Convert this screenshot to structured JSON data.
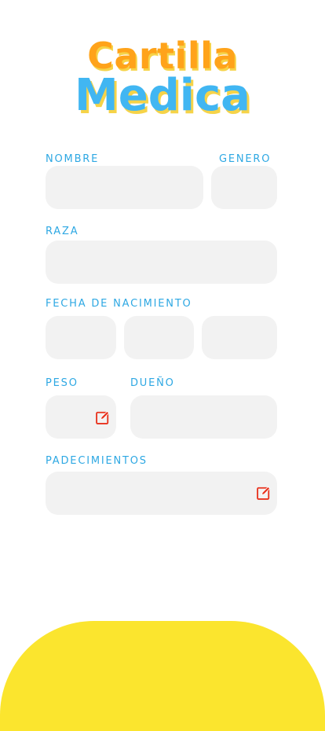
{
  "title": {
    "line1": "Cartilla",
    "line2": "Medica"
  },
  "form": {
    "nombre": {
      "label": "NOMBRE",
      "value": ""
    },
    "genero": {
      "label": "GENERO",
      "value": ""
    },
    "raza": {
      "label": "RAZA",
      "value": ""
    },
    "fecha": {
      "label": "FECHA DE NACIMIENTO",
      "day": "",
      "month": "",
      "year": ""
    },
    "peso": {
      "label": "PESO",
      "value": "",
      "icon": "edit-icon"
    },
    "dueno": {
      "label": "DUEÑO",
      "value": ""
    },
    "padecimientos": {
      "label": "PADECIMIENTOS",
      "value": "",
      "icon": "edit-icon"
    }
  },
  "colors": {
    "accent_blue": "#41B6F2",
    "accent_orange": "#FFA31A",
    "accent_yellow": "#FBE52E",
    "field_bg": "#F2F2F2",
    "icon_red": "#E8331E"
  }
}
